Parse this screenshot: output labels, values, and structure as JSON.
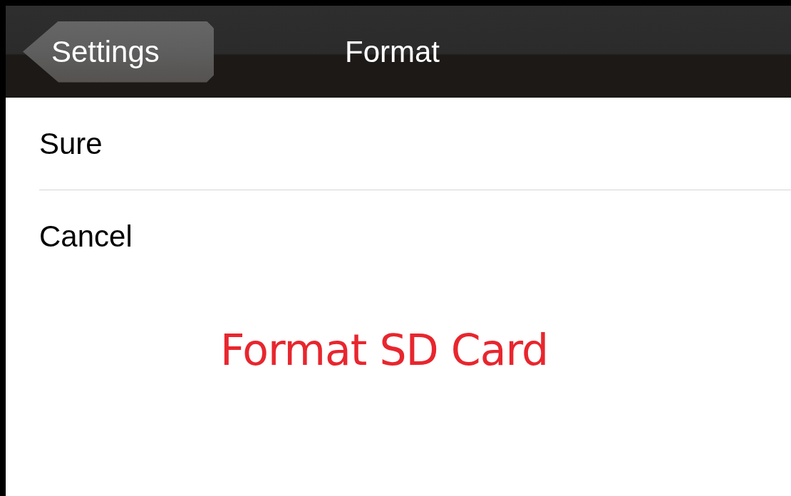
{
  "nav_bar": {
    "back_button": "Settings",
    "title": "Format"
  },
  "options": [
    {
      "label": "Sure"
    },
    {
      "label": "Cancel"
    }
  ],
  "caption": "Format SD Card"
}
